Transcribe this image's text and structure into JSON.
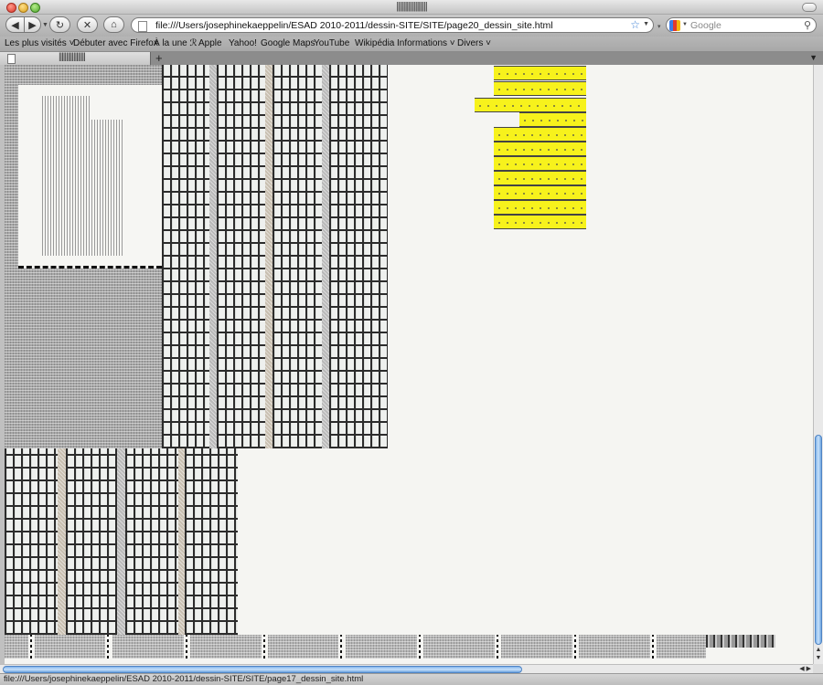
{
  "window": {
    "title": "||||||||||||||||||"
  },
  "toolbar": {
    "back_icon": "◀",
    "forward_icon": "▶",
    "reload_icon": "↻",
    "stop_icon": "✕",
    "home_icon": "⌂",
    "url": "file:///Users/josephinekaeppelin/ESAD 2010-2011/dessin-SITE/SITE/page20_dessin_site.html",
    "search_placeholder": "Google"
  },
  "bookmarks": [
    "Les plus visités ˅",
    "Débuter avec Firefox",
    "À la une ℛ",
    "Apple",
    "Yahoo!",
    "Google Maps",
    "YouTube",
    "Wikipédia",
    "Informations ˅",
    "Divers ˅"
  ],
  "tabs": [
    {
      "label": "||||||||||||||||||"
    }
  ],
  "new_tab_label": "+",
  "statusbar": {
    "text": "file:///Users/josephinekaeppelin/ESAD 2010-2011/dessin-SITE/SITE/page17_dessin_site.html"
  },
  "colors": {
    "yellow": "#f7f21c",
    "scrollbar": "#7fb2ea",
    "page_bg": "#f5f5f2"
  }
}
